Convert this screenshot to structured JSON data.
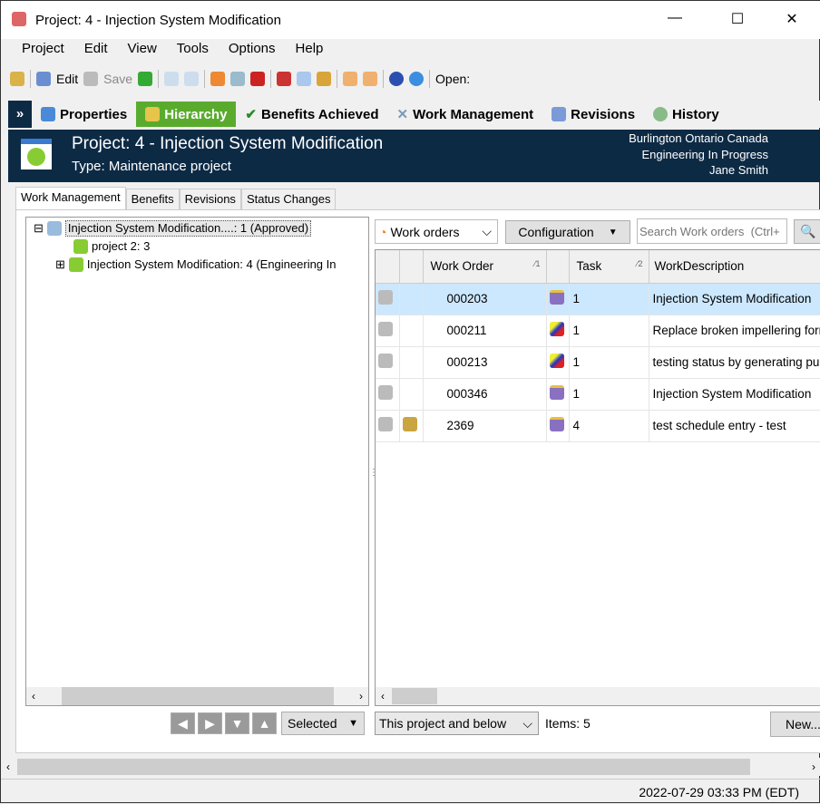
{
  "window": {
    "title": "Project: 4 - Injection System Modification",
    "minimize": "—",
    "maximize": "☐",
    "close": "✕"
  },
  "menu": [
    "Project",
    "Edit",
    "View",
    "Tools",
    "Options",
    "Help"
  ],
  "toolbar": {
    "edit": "Edit",
    "save": "Save",
    "open": "Open:"
  },
  "nav": {
    "items": [
      "Properties",
      "Hierarchy",
      "Benefits Achieved",
      "Work Management",
      "Revisions",
      "History"
    ],
    "active": "Hierarchy",
    "collapse": "»"
  },
  "header": {
    "title": "Project: 4 - Injection System Modification",
    "type": "Type: Maintenance project",
    "location": "Burlington Ontario Canada",
    "status": "Engineering In Progress",
    "owner": "Jane Smith"
  },
  "tabs": [
    "Work Management",
    "Benefits",
    "Revisions",
    "Status Changes"
  ],
  "tree": [
    "Injection System Modification....: 1 (Approved)",
    "project 2: 3",
    "Injection System Modification: 4 (Engineering In"
  ],
  "workorders": {
    "type_select": "Work orders",
    "config": "Configuration",
    "search_placeholder": "Search Work orders  (Ctrl+",
    "columns": {
      "wo": "Work Order",
      "wo_sort": "1",
      "task": "Task",
      "task_sort": "2",
      "desc": "WorkDescription"
    },
    "rows": [
      {
        "wo": "000203",
        "task": "1",
        "desc": "Injection System Modification"
      },
      {
        "wo": "000211",
        "task": "1",
        "desc": "Replace broken impellering form"
      },
      {
        "wo": "000213",
        "task": "1",
        "desc": "testing status by generating pu"
      },
      {
        "wo": "000346",
        "task": "1",
        "desc": "Injection System Modification"
      },
      {
        "wo": "2369",
        "task": "4",
        "desc": "test schedule entry - test"
      }
    ]
  },
  "bottom": {
    "selected": "Selected",
    "scope": "This project and below",
    "items": "Items: 5",
    "new": "New..."
  },
  "statusbar": {
    "datetime": "2022-07-29 03:33 PM (EDT)"
  }
}
